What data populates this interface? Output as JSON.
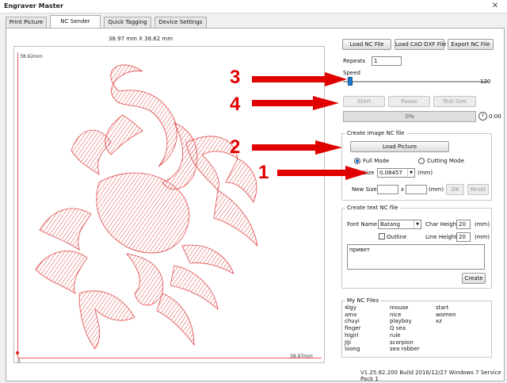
{
  "window": {
    "title": "Engraver Master",
    "close_glyph": "✕"
  },
  "tabs": [
    {
      "label": "Print Picture"
    },
    {
      "label": "NC Sender"
    },
    {
      "label": "Quick Tagging"
    },
    {
      "label": "Device Settings"
    }
  ],
  "canvas": {
    "size_label": "38.97 mm X 38.62 mm",
    "y_max_label": "38.62mm",
    "x_max_label": "38.97mm",
    "origin_label": "0",
    "image": "scorpion-engraving",
    "stroke_color": "#e04a4a"
  },
  "toolbar": {
    "load_nc": "Load NC File",
    "load_cad": "Load CAD DXF File",
    "export_nc": "Export NC File"
  },
  "repeats": {
    "label": "Repeats",
    "value": "1"
  },
  "speed": {
    "label": "Speed",
    "max": "120",
    "level": 0.05
  },
  "controls": {
    "start": "Start",
    "pause": "Pause",
    "test_size": "Test Size"
  },
  "progress": {
    "text": "0%",
    "time": "0:00"
  },
  "image_nc": {
    "title": "Create image NC file",
    "load_picture": "Load Picture",
    "full_mode": "Full Mode",
    "cutting_mode": "Cutting Mode",
    "size_label": "Size",
    "size_value": "0.08457",
    "size_unit": "(mm)",
    "new_size_label": "New Size",
    "new_size_x": "x",
    "new_size_unit": "(mm)",
    "ok": "OK",
    "reset": "Reset"
  },
  "text_nc": {
    "title": "Create text NC file",
    "font_name_label": "Font Name",
    "font_name_value": "Batang",
    "char_height_label": "Char Height",
    "char_height_value": "20",
    "char_height_unit": "(mm)",
    "outline_label": "Outline",
    "line_height_label": "Line Height",
    "line_height_value": "20",
    "line_height_unit": "(mm)",
    "text_value": "привет",
    "create": "Create"
  },
  "my_nc_files": {
    "title": "My NC Files",
    "col1": [
      "4lgy",
      "amo",
      "chuyi",
      "finger",
      "higirl",
      "JiJi",
      "loong"
    ],
    "col2": [
      "mouse",
      "nice",
      "playboy",
      "Q sea",
      "rule",
      "scorpion",
      "sea robber"
    ],
    "col3": [
      "start",
      "women",
      "xz"
    ]
  },
  "footer": "V1.25.82.200 Build 2016/12/27 Windows 7 Service Pack 1",
  "annotations": [
    {
      "number": "1"
    },
    {
      "number": "2"
    },
    {
      "number": "3"
    },
    {
      "number": "4"
    }
  ],
  "accent_color": "#e00000"
}
